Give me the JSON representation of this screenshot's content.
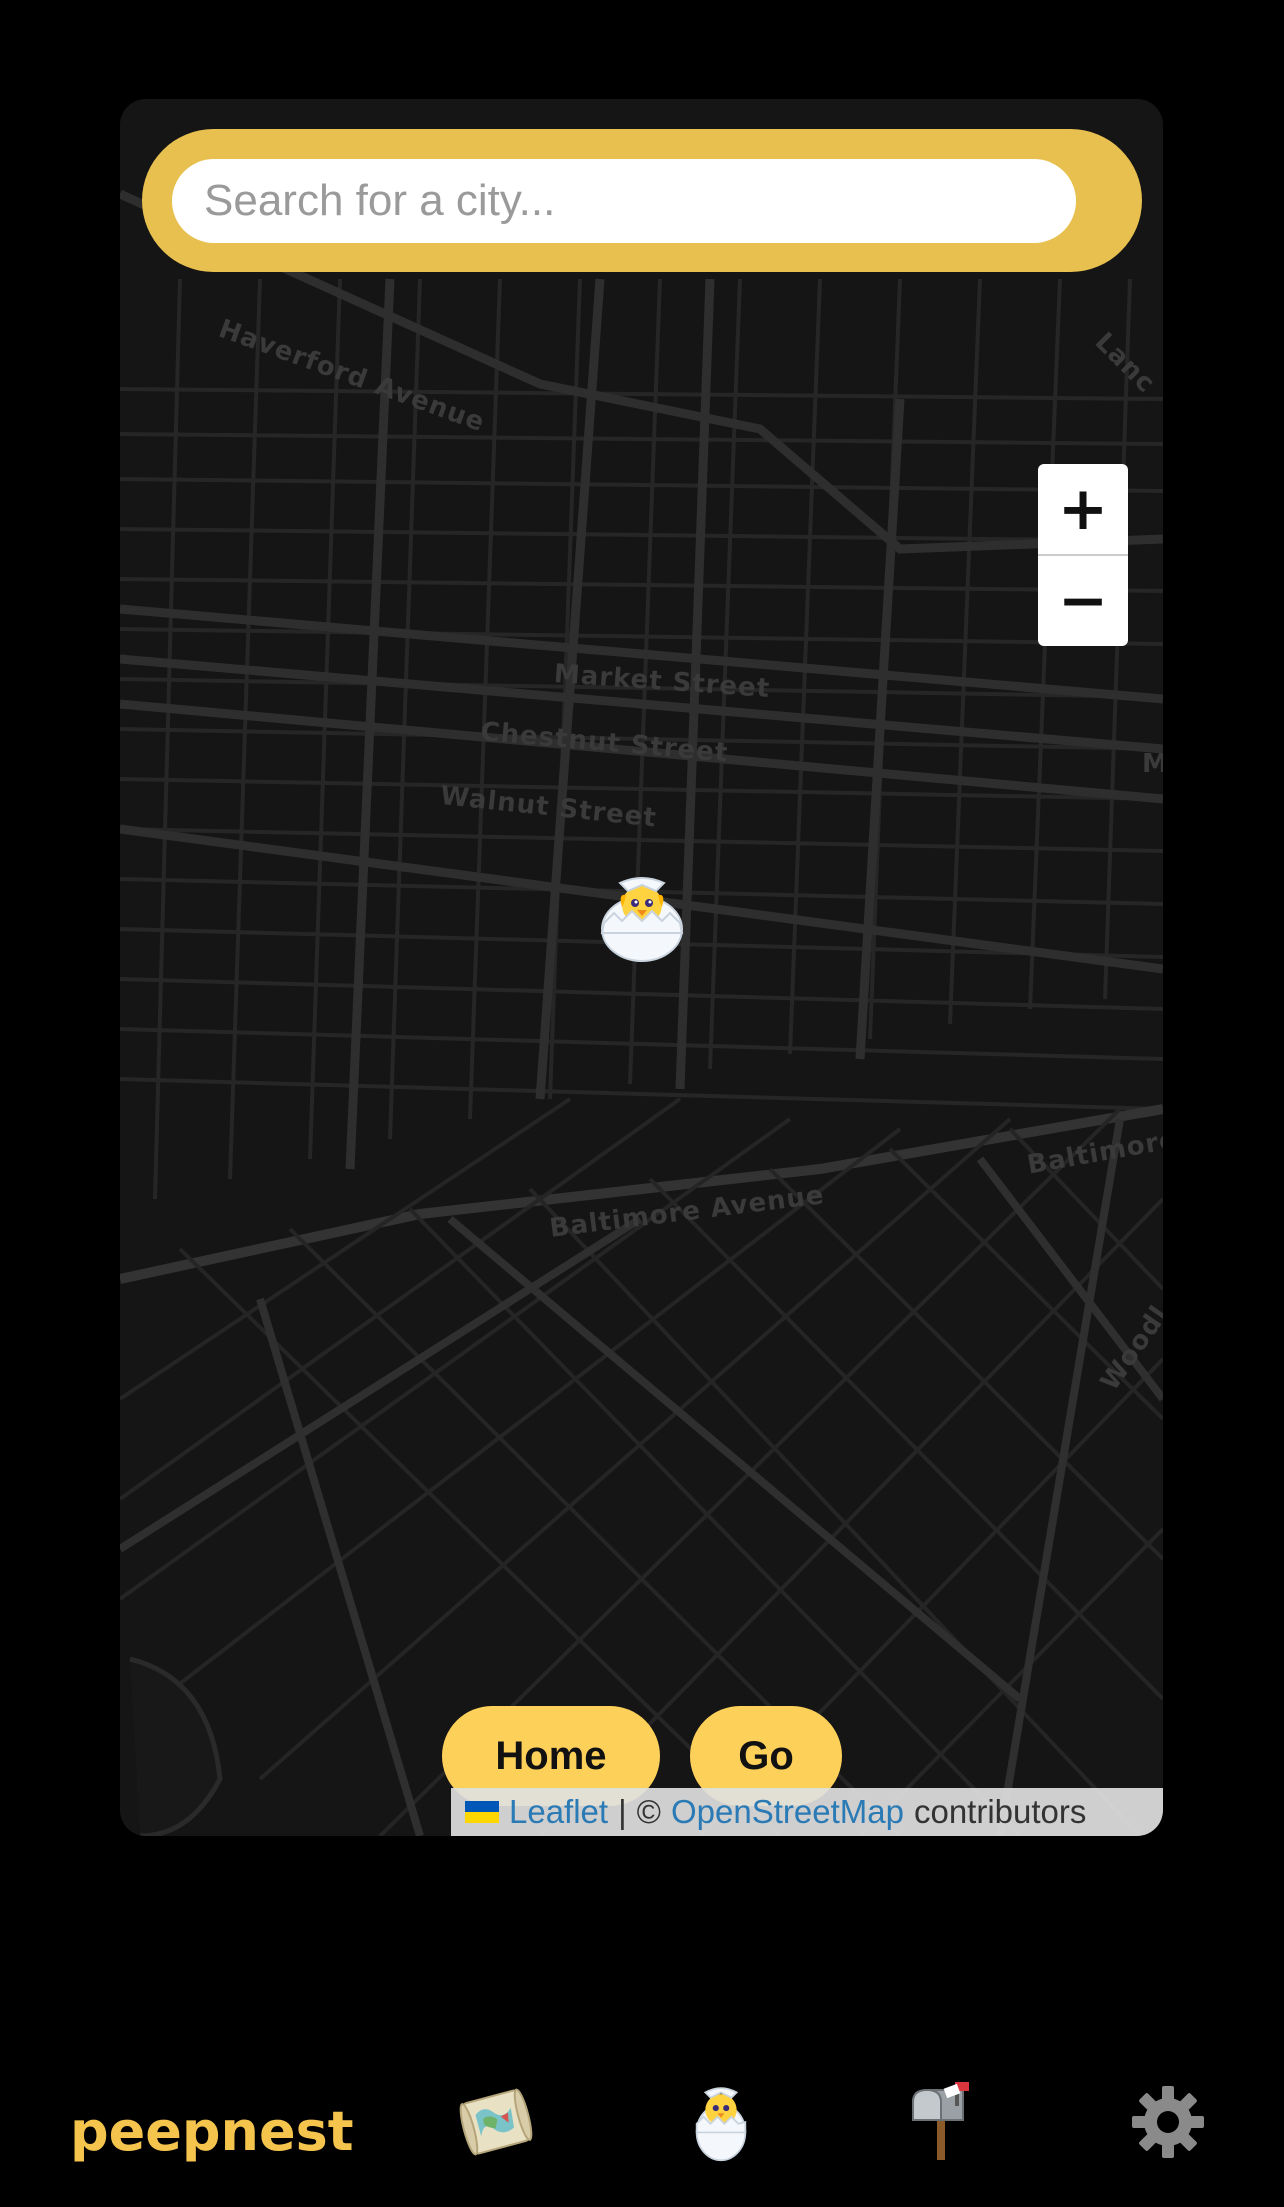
{
  "search": {
    "placeholder": "Search for a city..."
  },
  "zoom": {
    "in_label": "+",
    "out_label": "−"
  },
  "map": {
    "street_labels": [
      "Haverford Avenue",
      "Market Street",
      "Chestnut Street",
      "Walnut Street",
      "Baltimore Avenue",
      "Baltimore",
      "Woodl",
      "Lanc",
      "M"
    ],
    "marker_icon": "hatching-chick-icon"
  },
  "buttons": {
    "home": "Home",
    "go": "Go"
  },
  "attribution": {
    "leaflet": "Leaflet",
    "separator": "|",
    "copyright": "©",
    "osm": "OpenStreetMap",
    "suffix": "contributors"
  },
  "nav": {
    "brand": "peepnest",
    "items": [
      {
        "icon": "map-scroll-icon"
      },
      {
        "icon": "hatching-chick-icon"
      },
      {
        "icon": "mailbox-icon"
      },
      {
        "icon": "gear-icon"
      }
    ]
  },
  "colors": {
    "accent": "#fdd05a",
    "search_frame": "#e8c04f",
    "brand": "#f4c44d",
    "background": "#000000",
    "map": "#141414"
  }
}
